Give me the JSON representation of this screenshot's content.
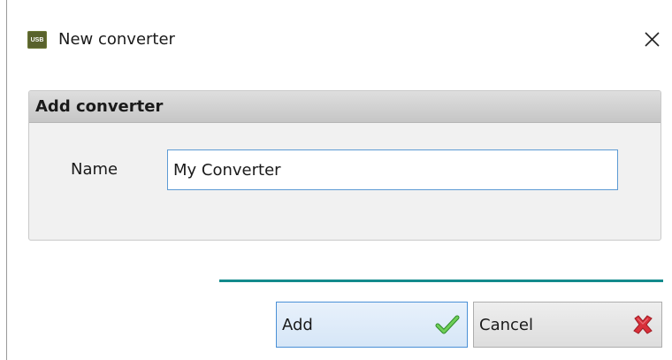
{
  "window": {
    "title": "New converter",
    "app_icon_text": "USB",
    "app_icon_color": "#59622c"
  },
  "group": {
    "header": "Add converter",
    "name_label": "Name",
    "name_value": "My Converter"
  },
  "buttons": {
    "add_label": "Add",
    "cancel_label": "Cancel"
  },
  "icons": {
    "close": "close-icon",
    "add": "checkmark-icon",
    "cancel": "red-x-icon"
  },
  "colors": {
    "separator": "#138a8c",
    "focus_border": "#5d9bd4",
    "checkmark": "#52b043",
    "cancel_x": "#d9303a"
  }
}
